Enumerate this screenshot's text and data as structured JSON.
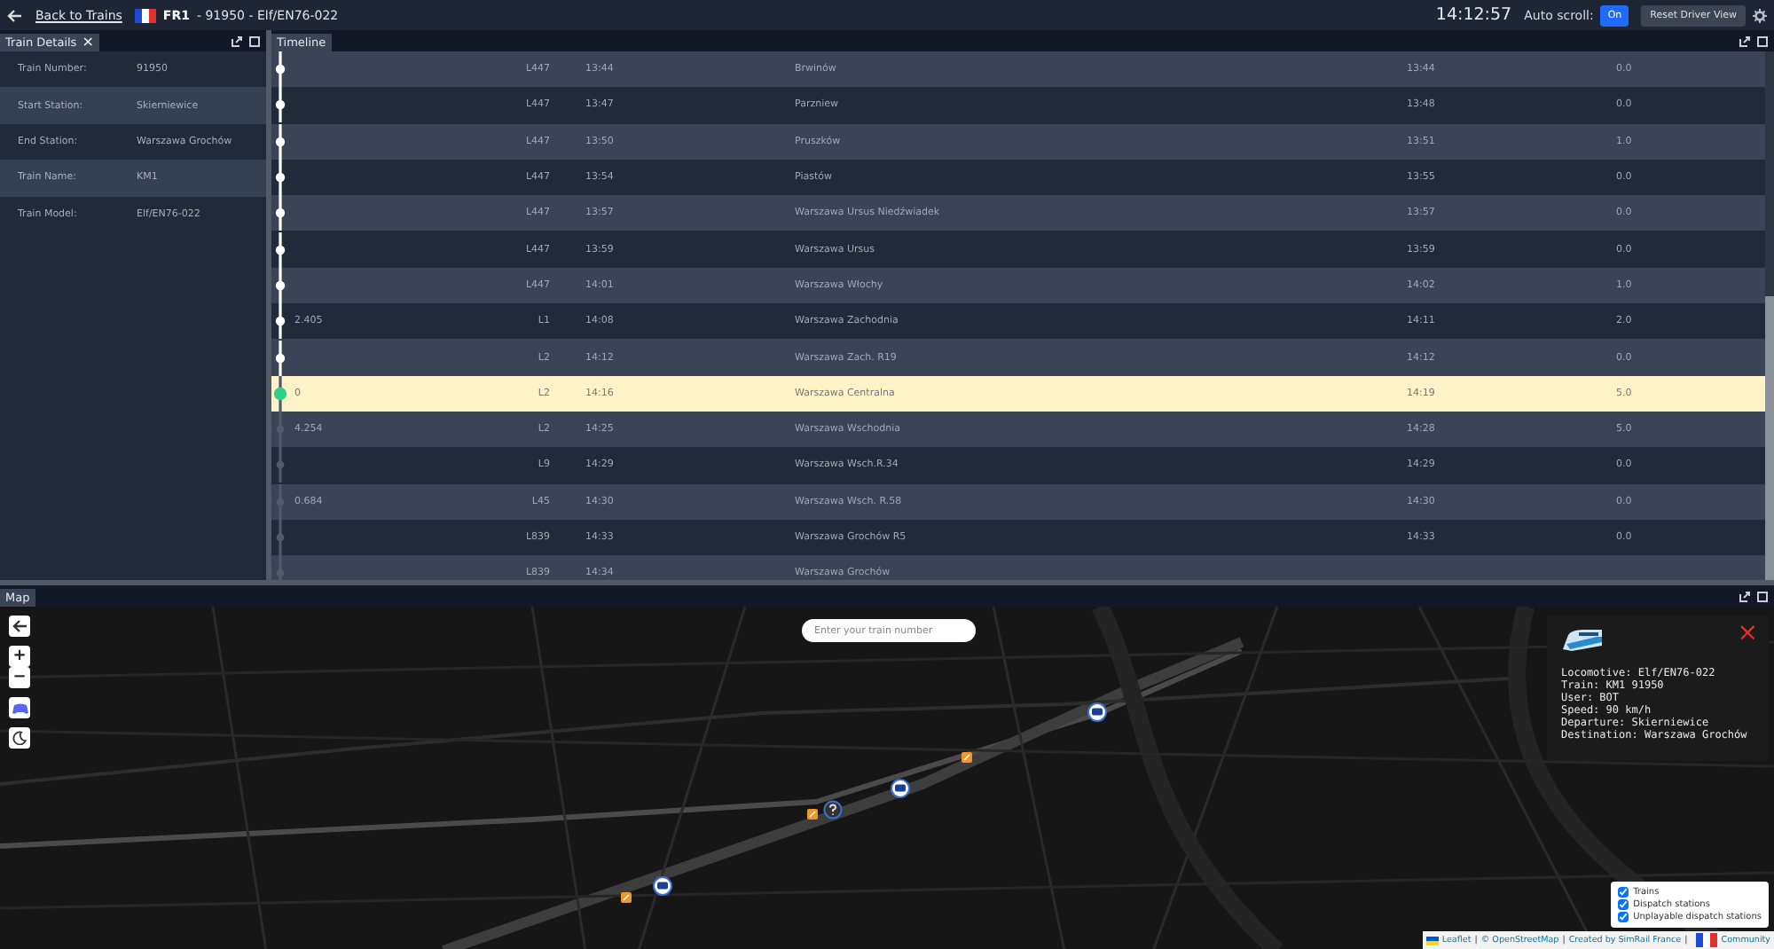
{
  "top_bar": {
    "back_link": "Back to Trains",
    "server": "FR1",
    "title": "- 91950 - Elf/EN76-022",
    "clock": "14:12:57",
    "auto_scroll_label": "Auto scroll:",
    "auto_scroll": {
      "label": "On",
      "on": true
    },
    "reset_button": "Reset Driver View"
  },
  "train_details": {
    "tab": "Train Details",
    "close": "×",
    "fields": [
      {
        "label": "Train Number:",
        "value": "91950"
      },
      {
        "label": "Start Station:",
        "value": "Skierniewice"
      },
      {
        "label": "End Station:",
        "value": "Warszawa Grochów"
      },
      {
        "label": "Train Name:",
        "value": "KM1"
      },
      {
        "label": "Train Model:",
        "value": "Elf/EN76-022"
      }
    ]
  },
  "timeline": {
    "tab": "Timeline",
    "rows": [
      {
        "kind": "passed",
        "column_1": "",
        "column_2": "L447",
        "column_3": "13:44",
        "column_4": "Brwinów",
        "column_5": "13:44",
        "column_6": "0.0"
      },
      {
        "kind": "passed",
        "column_1": "",
        "column_2": "L447",
        "column_3": "13:47",
        "column_4": "Parzniew",
        "column_5": "13:48",
        "column_6": "0.0"
      },
      {
        "kind": "passed",
        "column_1": "",
        "column_2": "L447",
        "column_3": "13:50",
        "column_4": "Pruszków",
        "column_5": "13:51",
        "column_6": "1.0"
      },
      {
        "kind": "passed",
        "column_1": "",
        "column_2": "L447",
        "column_3": "13:54",
        "column_4": "Piastów",
        "column_5": "13:55",
        "column_6": "0.0"
      },
      {
        "kind": "passed",
        "column_1": "",
        "column_2": "L447",
        "column_3": "13:57",
        "column_4": "Warszawa Ursus Niedźwiadek",
        "column_5": "13:57",
        "column_6": "0.0"
      },
      {
        "kind": "passed",
        "column_1": "",
        "column_2": "L447",
        "column_3": "13:59",
        "column_4": "Warszawa Ursus",
        "column_5": "13:59",
        "column_6": "0.0"
      },
      {
        "kind": "passed",
        "column_1": "",
        "column_2": "L447",
        "column_3": "14:01",
        "column_4": "Warszawa Włochy",
        "column_5": "14:02",
        "column_6": "1.0"
      },
      {
        "kind": "passed",
        "column_1": "2.405",
        "column_2": "L1",
        "column_3": "14:08",
        "column_4": "Warszawa Zachodnia",
        "column_5": "14:11",
        "column_6": "2.0"
      },
      {
        "kind": "passed",
        "column_1": "",
        "column_2": "L2",
        "column_3": "14:12",
        "column_4": "Warszawa Zach. R19",
        "column_5": "14:12",
        "column_6": "0.0"
      },
      {
        "kind": "current",
        "column_1": "0",
        "column_2": "L2",
        "column_3": "14:16",
        "column_4": "Warszawa Centralna",
        "column_5": "14:19",
        "column_6": "5.0"
      },
      {
        "kind": "upcoming",
        "column_1": "4.254",
        "column_2": "L2",
        "column_3": "14:25",
        "column_4": "Warszawa Wschodnia",
        "column_5": "14:28",
        "column_6": "5.0"
      },
      {
        "kind": "upcoming",
        "column_1": "",
        "column_2": "L9",
        "column_3": "14:29",
        "column_4": "Warszawa Wsch.R.34",
        "column_5": "14:29",
        "column_6": "0.0"
      },
      {
        "kind": "upcoming",
        "column_1": "0.684",
        "column_2": "L45",
        "column_3": "14:30",
        "column_4": "Warszawa Wsch. R.58",
        "column_5": "14:30",
        "column_6": "0.0"
      },
      {
        "kind": "upcoming",
        "column_1": "",
        "column_2": "L839",
        "column_3": "14:33",
        "column_4": "Warszawa Grochów R5",
        "column_5": "14:33",
        "column_6": "0.0"
      },
      {
        "kind": "upcoming",
        "column_1": "",
        "column_2": "L839",
        "column_3": "14:34",
        "column_4": "Warszawa Grochów",
        "column_5": "",
        "column_6": ""
      }
    ]
  },
  "map": {
    "tab": "Map",
    "search": {
      "placeholder": "Enter your train number"
    },
    "zoom_in": "+",
    "zoom_out": "−",
    "markers": [
      {
        "kind": "train"
      },
      {
        "kind": "train"
      },
      {
        "kind": "train"
      },
      {
        "kind": "unknown"
      },
      {
        "kind": "station"
      },
      {
        "kind": "station"
      },
      {
        "kind": "station"
      }
    ],
    "popup": {
      "close": "×",
      "lines": [
        "Locomotive: Elf/EN76-022",
        "Train: KM1 91950",
        "User: BOT",
        "Speed: 90 km/h",
        "Departure: Skierniewice",
        "Destination: Warszawa Grochów"
      ]
    },
    "layers": [
      {
        "label": "Trains",
        "checked": true
      },
      {
        "label": "Dispatch stations",
        "checked": true
      },
      {
        "label": "Unplayable dispatch stations",
        "checked": true
      }
    ],
    "attribution": {
      "links": [
        {
          "text": "Leaflet"
        },
        {
          "separator": "|",
          "text": "© OpenStreetMap"
        },
        {
          "separator": "|",
          "text": "Created by SimRail France"
        },
        {
          "separator": "|",
          "text": "Community"
        }
      ]
    }
  }
}
